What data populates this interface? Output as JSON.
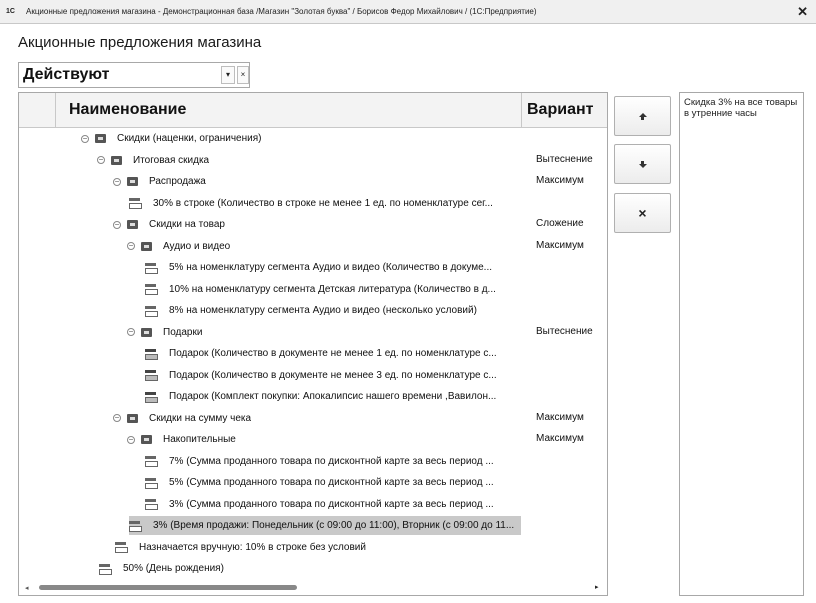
{
  "window": {
    "app_icon_text": "1С",
    "title": "Акционные предложения магазина - Демонстрационная база /Магазин \"Золотая буква\" / Борисов Федор Михайлович / (1С:Предприятие)"
  },
  "form": {
    "title": "Акционные предложения магазина"
  },
  "filter": {
    "value": "Действуют",
    "dropdown_glyph": "▾",
    "clear_glyph": "×"
  },
  "table": {
    "columns": [
      "Наименование",
      "Вариант"
    ],
    "rows": [
      {
        "text": "Скидки (наценки, ограничения)",
        "variant": "",
        "type": "group"
      },
      {
        "text": "Итоговая скидка",
        "variant": "Вытеснение",
        "type": "group"
      },
      {
        "text": "Распродажа",
        "variant": "Максимум",
        "type": "group"
      },
      {
        "text": "30% в строке (Количество в строке не менее 1 ед. по номенклатуре сег...",
        "variant": "",
        "type": "item"
      },
      {
        "text": "Скидки на товар",
        "variant": "Сложение",
        "type": "group"
      },
      {
        "text": "Аудио и видео",
        "variant": "Максимум",
        "type": "group"
      },
      {
        "text": "5% на номенклатуру сегмента Аудио и видео (Количество в докуме...",
        "variant": "",
        "type": "item"
      },
      {
        "text": "10% на номенклатуру сегмента Детская литература (Количество в д...",
        "variant": "",
        "type": "item"
      },
      {
        "text": "8% на номенклатуру сегмента Аудио и видео (несколько условий)",
        "variant": "",
        "type": "item"
      },
      {
        "text": "Подарки",
        "variant": "Вытеснение",
        "type": "group"
      },
      {
        "text": "Подарок (Количество в документе не менее 1 ед. по номенклатуре с...",
        "variant": "",
        "type": "gift"
      },
      {
        "text": "Подарок (Количество в документе не менее 3 ед. по номенклатуре с...",
        "variant": "",
        "type": "gift"
      },
      {
        "text": "Подарок (Комплект покупки: Апокалипсис нашего времени ,Вавилон...",
        "variant": "",
        "type": "gift"
      },
      {
        "text": "Скидки на сумму чека",
        "variant": "Максимум",
        "type": "group"
      },
      {
        "text": "Накопительные",
        "variant": "Максимум",
        "type": "group"
      },
      {
        "text": "7% (Сумма проданного товара по дисконтной карте за весь период ...",
        "variant": "",
        "type": "item"
      },
      {
        "text": "5% (Сумма проданного товара по дисконтной карте за весь период ...",
        "variant": "",
        "type": "item"
      },
      {
        "text": "3% (Сумма проданного товара по дисконтной карте за весь период ...",
        "variant": "",
        "type": "item"
      },
      {
        "text": "3% (Время продажи: Понедельник (с 09:00 до 11:00), Вторник (с 09:00 до 11...",
        "variant": "",
        "type": "item",
        "selected": true
      },
      {
        "text": "Назначается вручную: 10% в строке без условий",
        "variant": "",
        "type": "item"
      },
      {
        "text": "50% (День рождения)",
        "variant": "",
        "type": "item"
      }
    ]
  },
  "side_buttons": {
    "up": "move-up",
    "down": "move-down",
    "delete": "×"
  },
  "description": "Скидка 3% на все товары в утренние часы"
}
